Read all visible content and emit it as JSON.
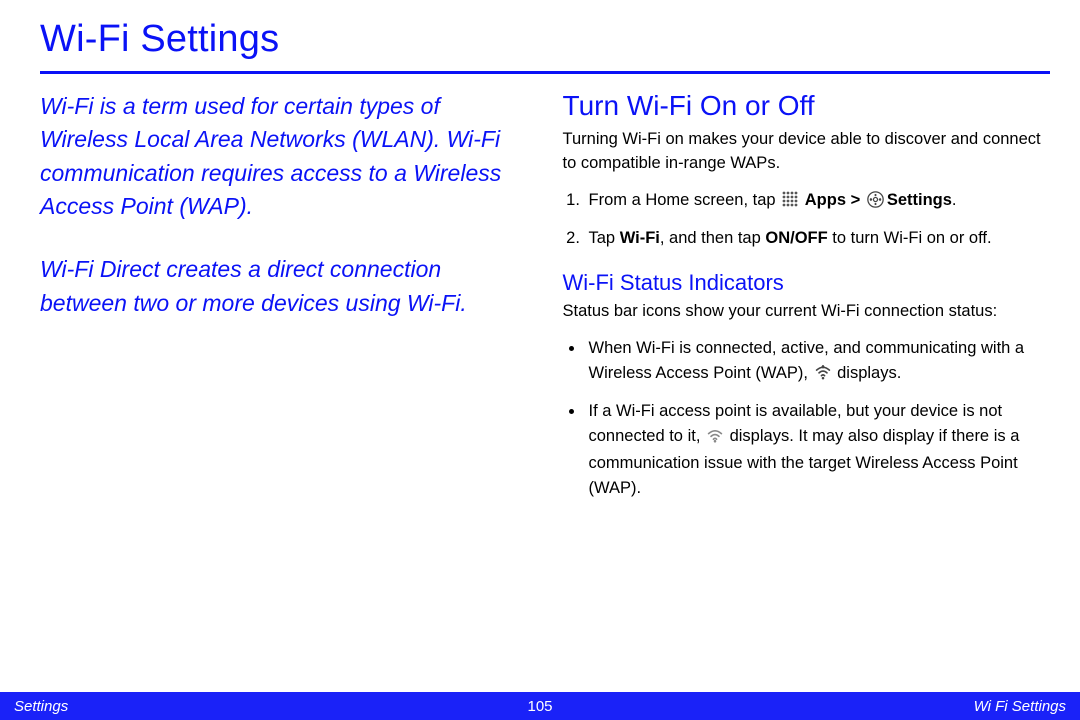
{
  "title": "Wi-Fi Settings",
  "intro": {
    "p1": "Wi-Fi is a term used for certain types of Wireless Local Area Networks (WLAN). Wi-Fi communication requires access to a Wireless Access Point (WAP).",
    "p2": "Wi-Fi Direct creates a direct connection between two or more devices using Wi-Fi."
  },
  "section_on_off": {
    "heading": "Turn Wi-Fi On or Off",
    "lead": "Turning Wi-Fi on makes your device able to discover and connect to compatible in-range WAPs.",
    "step1_pre": "From a Home screen, tap ",
    "step1_apps": "Apps",
    "step1_gt": " > ",
    "step1_settings": "Settings",
    "step1_post": ".",
    "step2_pre": "Tap ",
    "step2_wifi": "Wi-Fi",
    "step2_mid": ", and then tap ",
    "step2_onoff": "ON/OFF",
    "step2_post": " to turn Wi-Fi on or off."
  },
  "section_status": {
    "heading": "Wi-Fi Status Indicators",
    "lead": "Status bar icons show your current Wi-Fi connection status:",
    "b1_pre": "When Wi-Fi is connected, active, and communicating with a Wireless Access Point (WAP), ",
    "b1_post": " displays.",
    "b2_pre": "If a Wi-Fi access point is available, but your device is not connected to it, ",
    "b2_post": " displays. It may also display if there is a communication issue with the target Wireless Access Point (WAP)."
  },
  "footer": {
    "left": "Settings",
    "page": "105",
    "right": "Wi Fi Settings"
  }
}
